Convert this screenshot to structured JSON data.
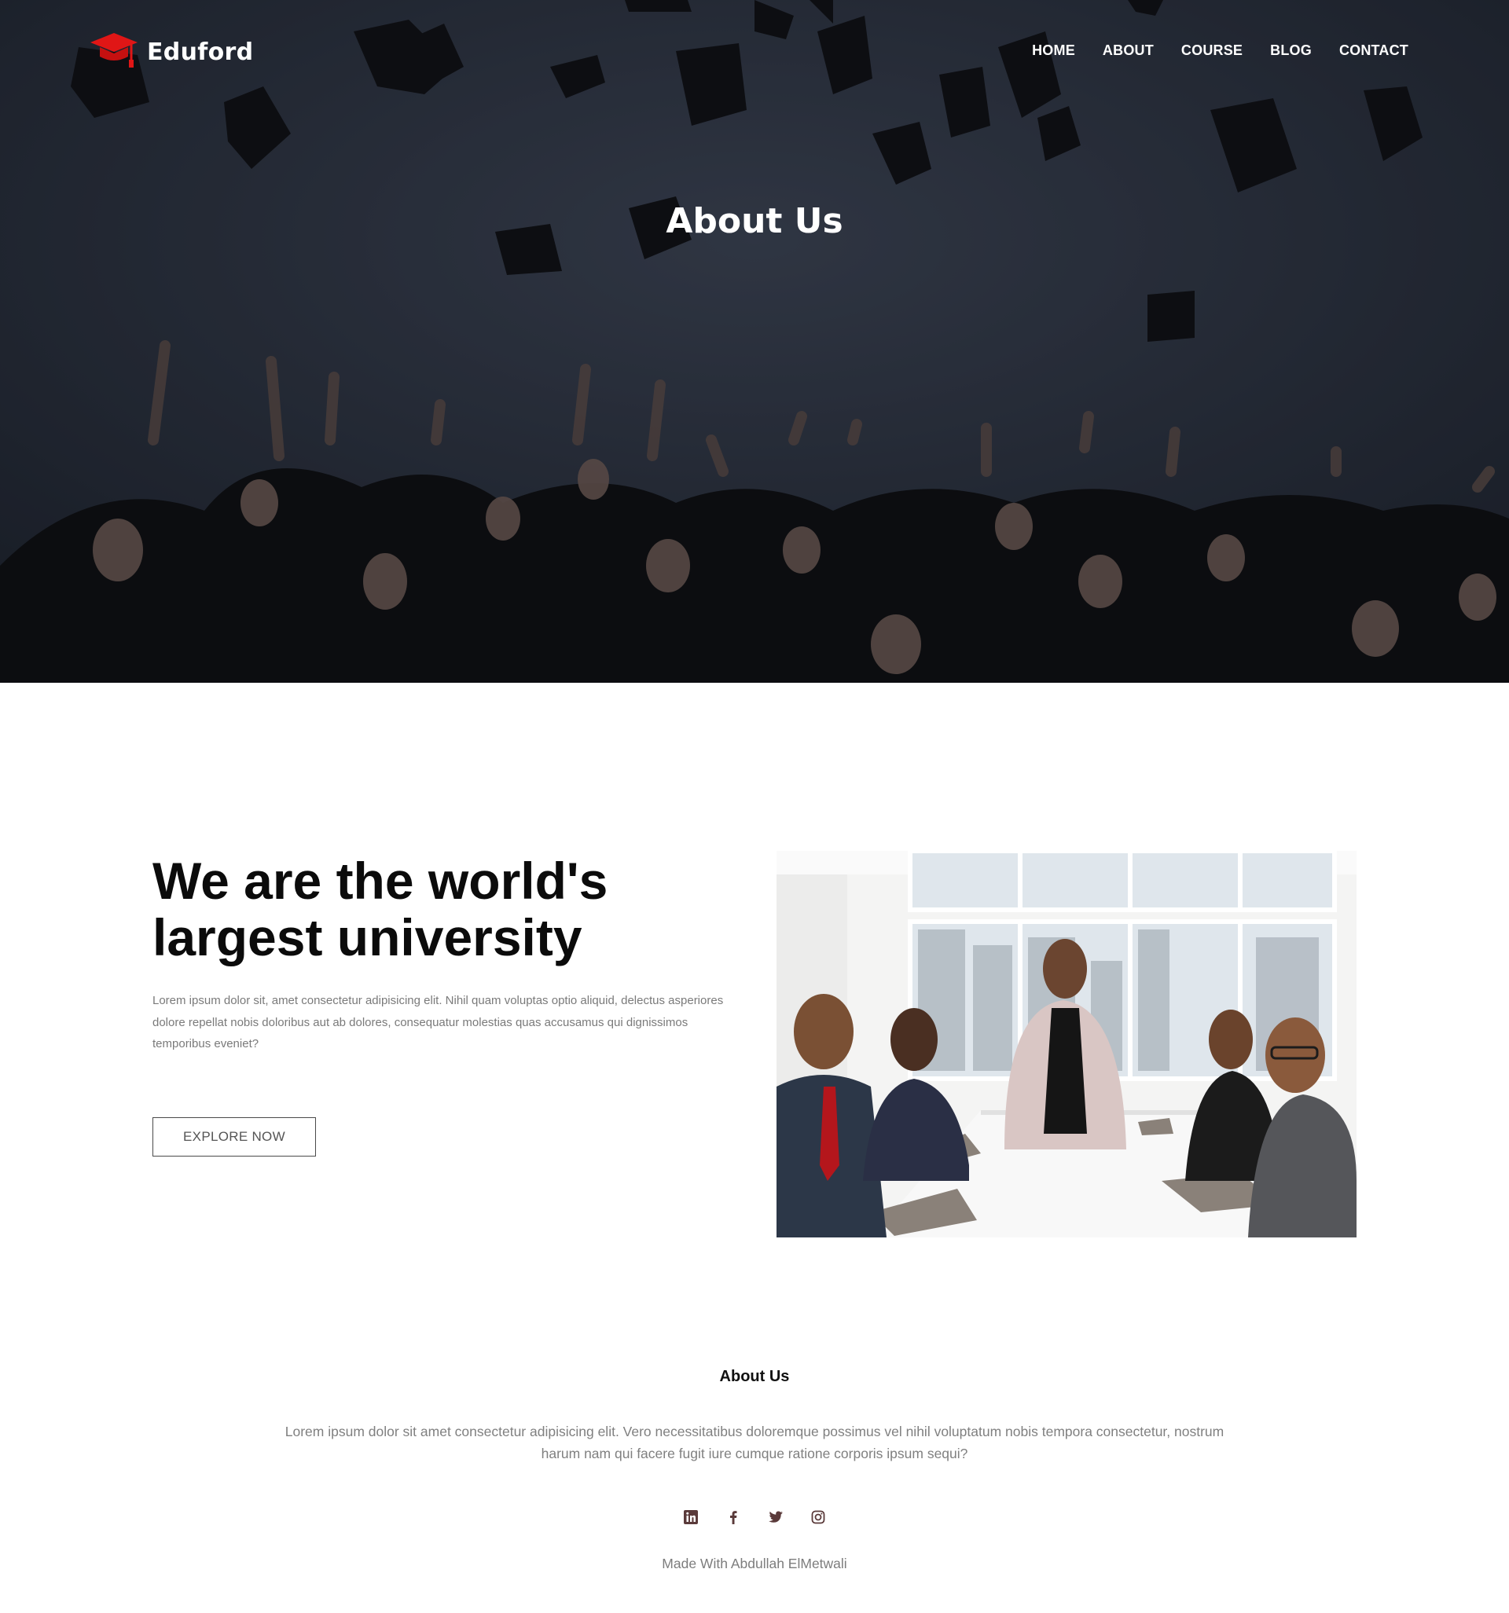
{
  "brand": {
    "name": "Eduford",
    "accent_color": "#e01616",
    "logo_icon": "graduation-cap-icon"
  },
  "nav": {
    "items": [
      {
        "label": "HOME"
      },
      {
        "label": "ABOUT"
      },
      {
        "label": "COURSE"
      },
      {
        "label": "BLOG"
      },
      {
        "label": "CONTACT"
      }
    ]
  },
  "hero": {
    "title": "About Us",
    "image": "graduates-throwing-caps-photo"
  },
  "intro": {
    "heading_line1": "We are the world's",
    "heading_line2": "largest university",
    "body": "Lorem ipsum dolor sit, amet consectetur adipisicing elit. Nihil quam voluptas optio aliquid, delectus asperiores dolore repellat nobis doloribus aut ab dolores, consequatur molestias quas accusamus qui dignissimos temporibus eveniet?",
    "button_label": "EXPLORE NOW",
    "image": "team-meeting-photo"
  },
  "footer": {
    "title": "About Us",
    "body": "Lorem ipsum dolor sit amet consectetur adipisicing elit. Vero necessitatibus doloremque possimus vel nihil voluptatum nobis tempora consectetur, nostrum harum nam qui facere fugit iure cumque ratione corporis ipsum sequi?",
    "social": [
      {
        "icon": "linkedin-icon"
      },
      {
        "icon": "facebook-icon"
      },
      {
        "icon": "twitter-icon"
      },
      {
        "icon": "instagram-icon"
      }
    ],
    "icon_color": "#5a3a3a",
    "credit": "Made With Abdullah ElMetwali"
  }
}
